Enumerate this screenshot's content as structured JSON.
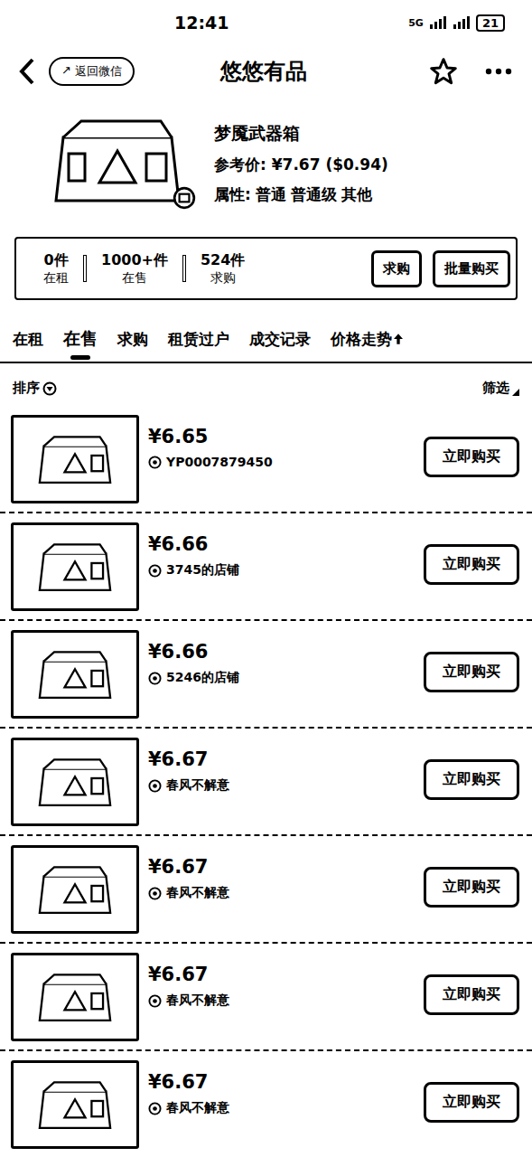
{
  "status_bar": {
    "time": "12:41",
    "network": "5G",
    "battery": "21"
  },
  "header": {
    "pill": "返回微信",
    "title": "悠悠有品"
  },
  "product": {
    "name": "梦魇武器箱",
    "price_label": "参考价:",
    "price": "¥7.67",
    "price_usd": "($0.94)",
    "attr_label": "属性:",
    "attrs": [
      "普通",
      "普通级",
      "其他"
    ]
  },
  "stats": [
    {
      "value": "0件",
      "label": "在租"
    },
    {
      "value": "1000+件",
      "label": "在售"
    },
    {
      "value": "524件",
      "label": "求购"
    }
  ],
  "actions": [
    "求购",
    "批量购买"
  ],
  "tabs": [
    {
      "label": "在租",
      "selected": false
    },
    {
      "label": "在售",
      "selected": true
    },
    {
      "label": "求购",
      "selected": false
    },
    {
      "label": "租赁过户",
      "selected": false
    },
    {
      "label": "成交记录",
      "selected": false
    },
    {
      "label": "价格走势",
      "selected": false
    }
  ],
  "sort": "排序",
  "filter": "筛选",
  "listings": [
    {
      "price": "¥6.65",
      "seller": "YP0007879450",
      "action": "立即购买"
    },
    {
      "price": "¥6.66",
      "seller": "3745的店铺",
      "action": "立即购买"
    },
    {
      "price": "¥6.66",
      "seller": "5246的店铺",
      "action": "立即购买"
    },
    {
      "price": "¥6.67",
      "seller": "春风不解意",
      "action": "立即购买"
    },
    {
      "price": "¥6.67",
      "seller": "春风不解意",
      "action": "立即购买"
    },
    {
      "price": "¥6.67",
      "seller": "春风不解意",
      "action": "立即购买"
    },
    {
      "price": "¥6.67",
      "seller": "春风不解意",
      "action": "立即购买"
    }
  ]
}
